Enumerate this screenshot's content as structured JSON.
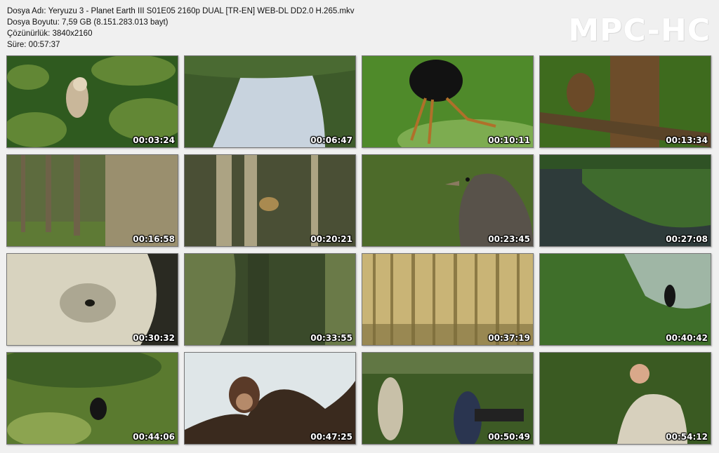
{
  "file_info": {
    "name_line": "Dosya Adı: Yeryuzu 3 - Planet Earth III S01E05 2160p DUAL [TR-EN] WEB-DL DD2.0 H.265.mkv",
    "size_line": "Dosya Boyutu: 7,59 GB (8.151.283.013 bayt)",
    "resolution_line": "Çözünürlük: 3840x2160",
    "duration_line": "Süre: 00:57:37"
  },
  "logo": "MPC-HC",
  "thumbnails": [
    {
      "time": "00:03:24",
      "scene": "eagle-in-foliage",
      "colors": [
        "#2f5a1f",
        "#6b8f3a"
      ]
    },
    {
      "time": "00:06:47",
      "scene": "tree-canopy-sky",
      "colors": [
        "#c8d3de",
        "#3d5a2a"
      ]
    },
    {
      "time": "00:10:11",
      "scene": "insect-macro",
      "colors": [
        "#4f8a2a",
        "#9cc36a"
      ]
    },
    {
      "time": "00:13:34",
      "scene": "beetle-on-tree",
      "colors": [
        "#3e6b1e",
        "#6d4d2a"
      ]
    },
    {
      "time": "00:16:58",
      "scene": "forest-trunks",
      "colors": [
        "#5d6b3e",
        "#9a8f6e"
      ]
    },
    {
      "time": "00:20:21",
      "scene": "forest-leopard",
      "colors": [
        "#4a4f35",
        "#b7ad8c"
      ]
    },
    {
      "time": "00:23:45",
      "scene": "spotted-bird",
      "colors": [
        "#4d6b2a",
        "#58524a"
      ]
    },
    {
      "time": "00:27:08",
      "scene": "lake-forest-aerial",
      "colors": [
        "#2e3b3a",
        "#3f6b2d"
      ]
    },
    {
      "time": "00:30:32",
      "scene": "furry-animal-closeup",
      "colors": [
        "#d8d3bf",
        "#8f8a74"
      ]
    },
    {
      "time": "00:33:55",
      "scene": "giant-tree-trunk",
      "colors": [
        "#3a4a2a",
        "#6a7a48"
      ]
    },
    {
      "time": "00:37:19",
      "scene": "tree-plantation",
      "colors": [
        "#8c7a45",
        "#c9b476"
      ]
    },
    {
      "time": "00:40:42",
      "scene": "chimp-in-tree",
      "colors": [
        "#3f6f2a",
        "#c9d4da"
      ]
    },
    {
      "time": "00:44:06",
      "scene": "chimp-on-ground",
      "colors": [
        "#5a7a2f",
        "#8ca450"
      ]
    },
    {
      "time": "00:47:25",
      "scene": "chimp-portrait",
      "colors": [
        "#dfe6e8",
        "#3a2a1e"
      ]
    },
    {
      "time": "00:50:49",
      "scene": "film-crew-forest",
      "colors": [
        "#3d5a25",
        "#7a8a5a"
      ]
    },
    {
      "time": "00:54:12",
      "scene": "presenter-in-forest",
      "colors": [
        "#3a5a22",
        "#d7d0bd"
      ]
    }
  ]
}
